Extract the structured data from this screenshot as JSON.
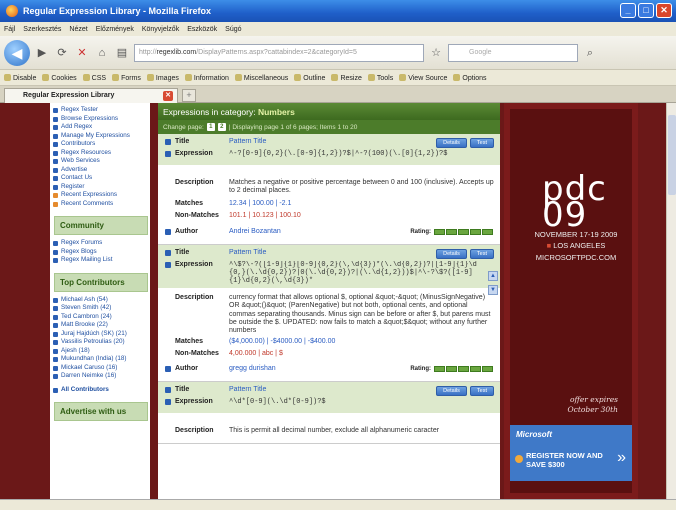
{
  "window": {
    "title": "Regular Expression Library - Mozilla Firefox"
  },
  "menubar": [
    "Fájl",
    "Szerkesztés",
    "Nézet",
    "Előzmények",
    "Könyvjelzők",
    "Eszközök",
    "Súgó"
  ],
  "navbar": {
    "url_host": "regexlib.com",
    "url_prefix": "http://",
    "url_rest": "/DisplayPatterns.aspx?cattabindex=2&categoryId=5",
    "search_placeholder": "Google"
  },
  "devbar": [
    "Disable",
    "Cookies",
    "CSS",
    "Forms",
    "Images",
    "Information",
    "Miscellaneous",
    "Outline",
    "Resize",
    "Tools",
    "View Source",
    "Options"
  ],
  "tab": {
    "title": "Regular Expression Library"
  },
  "sidebar": {
    "menu": [
      "Regex Tester",
      "Browse Expressions",
      "Add Regex",
      "Manage My Expressions",
      "Contributors",
      "Regex Resources",
      "Web Services",
      "Advertise",
      "Contact Us",
      "Register"
    ],
    "menu_orange": [
      "Recent Expressions",
      "Recent Comments"
    ],
    "community_title": "Community",
    "community": [
      "Regex Forums",
      "Regex Blogs",
      "Regex Mailing List"
    ],
    "contributors_title": "Top Contributors",
    "contributors": [
      "Michael Ash (54)",
      "Steven Smith (42)",
      "Ted Cambron (24)",
      "Matt Brooke (22)",
      "Juraj Hajdúch (SK) (21)",
      "Vassilis Petroulias (20)",
      "Ajesh (18)",
      "Mukundhan (India) (18)",
      "Mickael Caruso (16)",
      "Darren Neimke (16)"
    ],
    "all_contributors": "All Contributors",
    "advertise_title": "Advertise with us"
  },
  "main": {
    "header_prefix": "Expressions in category: ",
    "header_category": "Numbers",
    "change_page": "Change page:",
    "page_next": "1",
    "page_last": "2",
    "page_info": "|  Displaying page 1 of 6 pages; Items 1 to 20",
    "labels": {
      "title": "Title",
      "expression": "Expression",
      "description": "Description",
      "matches": "Matches",
      "non_matches": "Non-Matches",
      "author": "Author",
      "rating": "Rating:",
      "details": "Details",
      "test": "Test"
    },
    "entries": [
      {
        "title": "Pattern Title",
        "expression": "^-?[0-9]{0,2}(\\.[0-9]{1,2})?$|^-?(100)(\\.[0]{1,2})?$",
        "description": "Matches a negative or positive percentage between 0 and 100 (inclusive). Accepts up to 2 decimal places.",
        "matches": "12.34  |  100.00  |  -2.1",
        "non_matches": "101.1  |  10.123  |  100.10",
        "author": "Andrei Bozantan"
      },
      {
        "title": "Pattern Title",
        "expression": "^\\$?\\-?([1-9]{1}[0-9]{0,2}(\\,\\d{3})*(\\.\\d{0,2})?|[1-9]{1}\\d{0,}(\\.\\d{0,2})?|0(\\.\\d{0,2})?|(\\.\\d{1,2}))$|^\\-?\\$?([1-9]{1}\\d{0,2}(\\,\\d{3})*",
        "description": "currency format that allows optional $, optional &quot;-&quot; (MinusSignNegative) OR &quot;()&quot; (ParenNegative) but not both, optional cents, and optional commas separating thousands. Minus sign can be before or after $, but parens must be outside the $. UPDATED: now fails to match a &quot;$&quot; without any further numbers",
        "matches": "($4,000.00)  |  -$4000.00  |  -$400.00",
        "non_matches": "4,00.000  |  abc  |  $",
        "author": "gregg durishan"
      },
      {
        "title": "Pattern Title",
        "expression": "^\\d*[0-9](\\.\\d*[0-9])?$",
        "description": "This is permit all decimal number, exclude all alphanumeric caracter",
        "matches": "",
        "non_matches": "",
        "author": ""
      }
    ]
  },
  "ad": {
    "logo": "pdc",
    "year": "09",
    "date": "NOVEMBER 17-19 2009",
    "location": "LOS ANGELES",
    "site": "MICROSOFTPDC.COM",
    "offer": "offer expires October 30th",
    "brand": "Microsoft",
    "register": "REGISTER NOW AND SAVE $300"
  },
  "colors": {
    "sidebar_head": "#c8dcb4",
    "main_header": "#4c7c2a",
    "link": "#2a5cc2",
    "page_bg": "#6b1818"
  }
}
